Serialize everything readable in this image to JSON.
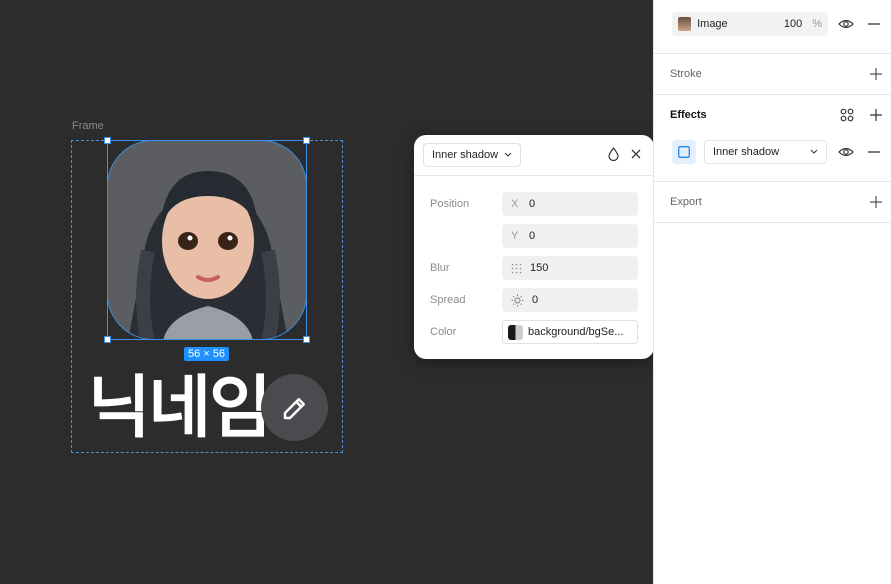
{
  "canvas": {
    "frame_label": "Frame",
    "size_badge": "56 × 56",
    "nickname_text": "닉네임",
    "avatar_icon": "girl-portrait",
    "edit_icon": "pencil-icon"
  },
  "popup": {
    "type_value": "Inner shadow",
    "position_label": "Position",
    "x_prefix": "X",
    "x_value": "0",
    "y_prefix": "Y",
    "y_value": "0",
    "blur_label": "Blur",
    "blur_value": "150",
    "spread_label": "Spread",
    "spread_value": "0",
    "color_label": "Color",
    "color_value": "background/bgSe..."
  },
  "panel": {
    "fill": {
      "label": "Image",
      "opacity": "100",
      "unit": "%"
    },
    "stroke_title": "Stroke",
    "effects_title": "Effects",
    "effect_type": "Inner shadow",
    "export_title": "Export"
  },
  "colors": {
    "accent": "#3b91e8",
    "canvas": "#2c2c2c",
    "badge": "#1e90ff"
  }
}
